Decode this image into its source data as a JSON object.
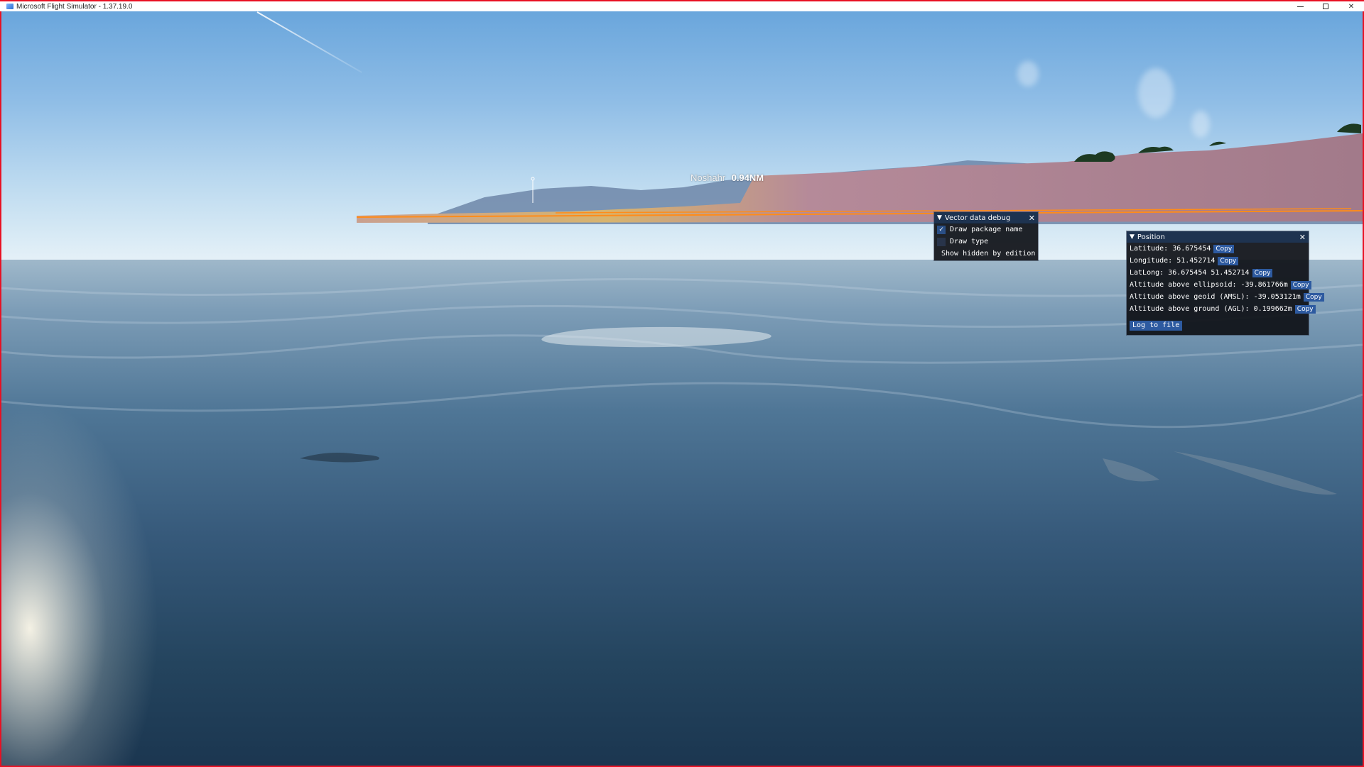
{
  "window": {
    "title": "Microsoft Flight Simulator - 1.37.19.0",
    "controls": {
      "minimize": "minimize-icon",
      "maximize": "maximize-icon",
      "close": "✕"
    }
  },
  "scene": {
    "location_label": "Noshahr",
    "distance_label": "0.94NM"
  },
  "vector_panel": {
    "title": "Vector data debug",
    "close": "✕",
    "options": [
      {
        "label": "Draw package name",
        "checked": true
      },
      {
        "label": "Draw type",
        "checked": false
      },
      {
        "label": "Show hidden by edition",
        "checked": false
      }
    ]
  },
  "position_panel": {
    "title": "Position",
    "close": "✕",
    "rows": [
      {
        "text": "Latitude: 36.675454",
        "button": "Copy"
      },
      {
        "text": "Longitude: 51.452714",
        "button": "Copy"
      },
      {
        "text": "LatLong: 36.675454 51.452714",
        "button": "Copy"
      },
      {
        "text": "Altitude above ellipsoid: -39.861766m",
        "button": "Copy"
      },
      {
        "text": "Altitude above geoid (AMSL): -39.053121m",
        "button": "Copy"
      },
      {
        "text": "Altitude above ground (AGL): 0.199662m",
        "button": "Copy"
      }
    ],
    "log_button": "Log to file"
  },
  "colors": {
    "accent_border": "#e81123",
    "panel_header": "#1e3350",
    "button_blue": "#2d5aa0",
    "vector_overlay": "#ff8c1a"
  }
}
